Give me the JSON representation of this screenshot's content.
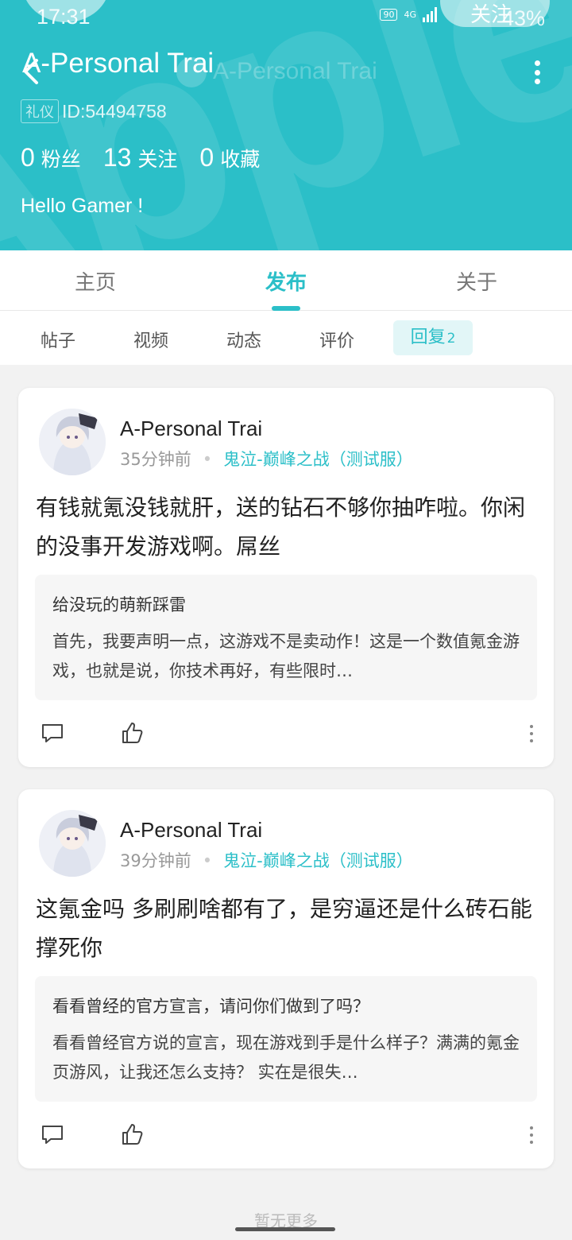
{
  "status_bar": {
    "time": "17:31",
    "network_hd": "HD",
    "network_4g": "4G",
    "battery": "43%"
  },
  "header": {
    "title": "A-Personal Trai",
    "title_ghost": "A-Personal Trai",
    "follow_label": "关注",
    "id_badge": "礼仪",
    "id_text": "ID:54494758",
    "stats": [
      {
        "num": "0",
        "label": "粉丝"
      },
      {
        "num": "13",
        "label": "关注"
      },
      {
        "num": "0",
        "label": "收藏"
      }
    ],
    "bio": "Hello Gamer !",
    "accent_color": "#2bbfc8"
  },
  "main_tabs": [
    {
      "label": "主页"
    },
    {
      "label": "发布"
    },
    {
      "label": "关于"
    }
  ],
  "sub_tabs": [
    {
      "label": "帖子"
    },
    {
      "label": "视频"
    },
    {
      "label": "动态"
    },
    {
      "label": "评价"
    },
    {
      "label": "回复",
      "badge": "2"
    }
  ],
  "posts": [
    {
      "author": "A-Personal Trai",
      "time_ago": "35分钟前",
      "separator": "•",
      "game": "鬼泣-巅峰之战（测试服）",
      "content": "有钱就氪没钱就肝，送的钻石不够你抽咋啦。你闲的没事开发游戏啊。屌丝",
      "quote_title": "给没玩的萌新踩雷",
      "quote_body": "首先，我要声明一点，这游戏不是卖动作！这是一个数值氪金游戏，也就是说，你技术再好，有些限时…"
    },
    {
      "author": "A-Personal Trai",
      "time_ago": "39分钟前",
      "separator": "•",
      "game": "鬼泣-巅峰之战（测试服）",
      "content": "这氪金吗 多刷刷啥都有了，是穷逼还是什么砖石能撑死你",
      "quote_title": "看看曾经的官方宣言，请问你们做到了吗？",
      "quote_body": "看看曾经官方说的宣言，现在游戏到手是什么样子？满满的氪金页游风，让我还怎么支持？ 实在是很失…"
    }
  ],
  "footer_hint": "暂无更多"
}
